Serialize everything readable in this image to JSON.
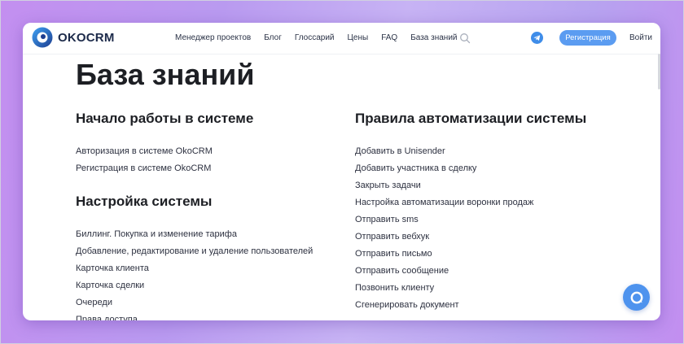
{
  "header": {
    "logo_text": "OKOCRM",
    "nav": [
      {
        "label": "Менеджер проектов"
      },
      {
        "label": "Блог"
      },
      {
        "label": "Глоссарий"
      },
      {
        "label": "Цены"
      },
      {
        "label": "FAQ"
      },
      {
        "label": "База знаний"
      }
    ],
    "register_label": "Регистрация",
    "login_label": "Войти"
  },
  "main": {
    "title": "База знаний",
    "sections_left": [
      {
        "title": "Начало работы в системе",
        "items": [
          "Авторизация в системе OkoCRM",
          "Регистрация в системе OkoCRM"
        ]
      },
      {
        "title": "Настройка системы",
        "items": [
          "Биллинг. Покупка и изменение тарифа",
          "Добавление, редактирование и удаление пользователей",
          "Карточка клиента",
          "Карточка сделки",
          "Очереди",
          "Права доступа"
        ]
      }
    ],
    "section_right": {
      "title": "Правила автоматизации системы",
      "items": [
        "Добавить в Unisender",
        "Добавить участника в сделку",
        "Закрыть задачи",
        "Настройка автоматизации воронки продаж",
        "Отправить sms",
        "Отправить вебхук",
        "Отправить письмо",
        "Отправить сообщение",
        "Позвонить клиенту",
        "Сгенерировать документ"
      ]
    }
  },
  "colors": {
    "accent": "#5b9cf1",
    "background_gradient": "#c38ff0",
    "text": "#1d1f24"
  },
  "icons": [
    "logo-icon",
    "search-icon",
    "telegram-icon",
    "chat-icon"
  ]
}
